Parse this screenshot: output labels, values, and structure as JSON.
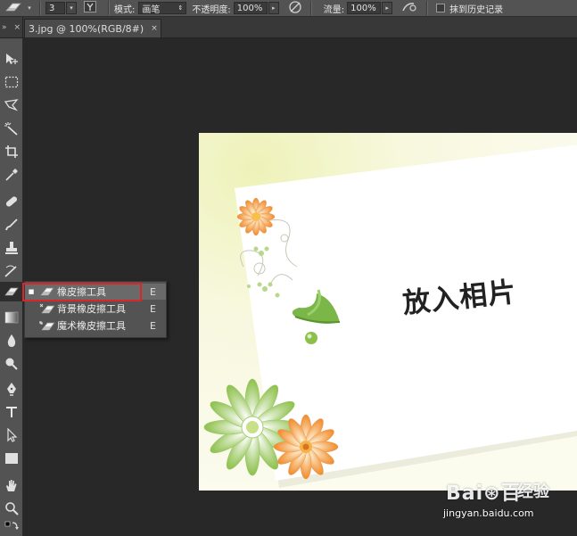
{
  "options_bar": {
    "brush_size": "3",
    "mode_label": "模式:",
    "mode_value": "画笔",
    "opacity_label": "不透明度:",
    "opacity_value": "100%",
    "flow_label": "流量:",
    "flow_value": "100%",
    "erase_history_label": "抹到历史记录"
  },
  "document_tab": {
    "title": "3.jpg @ 100%(RGB/8#)",
    "close": "×"
  },
  "panel_controls": {
    "collapse": "»",
    "close": "×"
  },
  "tool_flyout": {
    "items": [
      {
        "label": "橡皮擦工具",
        "shortcut": "E",
        "selected": true,
        "icon": "eraser-icon"
      },
      {
        "label": "背景橡皮擦工具",
        "shortcut": "E",
        "selected": false,
        "icon": "background-eraser-icon"
      },
      {
        "label": "魔术橡皮擦工具",
        "shortcut": "E",
        "selected": false,
        "icon": "magic-eraser-icon"
      }
    ],
    "highlight_color": "#d8262c"
  },
  "canvas": {
    "title": "放入相片",
    "accent_orange": "#f08a2a",
    "accent_green": "#7ab648"
  },
  "watermark": {
    "logo": "Bai⊛百",
    "jingyan": "经验",
    "url": "jingyan.baidu.com"
  },
  "colors": {
    "ui_bg": "#282828",
    "toolbar_bg": "#535353",
    "selection_red": "#d8262c"
  }
}
